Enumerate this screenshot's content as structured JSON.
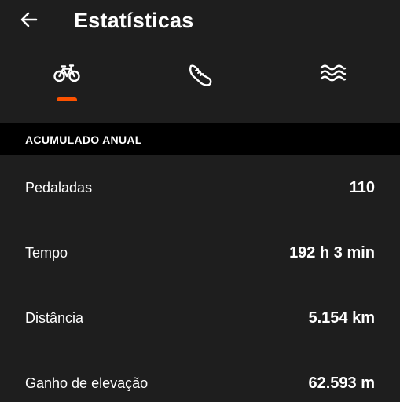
{
  "header": {
    "title": "Estatísticas",
    "back_icon": "arrow-left-icon"
  },
  "tabs": [
    {
      "name": "ride",
      "icon": "bike-icon",
      "active": true
    },
    {
      "name": "run",
      "icon": "shoe-icon",
      "active": false
    },
    {
      "name": "swim",
      "icon": "waves-icon",
      "active": false
    }
  ],
  "colors": {
    "background": "#1e1e1e",
    "section_header_bg": "#000000",
    "accent": "#fc5200",
    "text": "#ffffff"
  },
  "section": {
    "title": "ACUMULADO ANUAL"
  },
  "stats": [
    {
      "label": "Pedaladas",
      "value": "110"
    },
    {
      "label": "Tempo",
      "value": "192 h 3 min"
    },
    {
      "label": "Distância",
      "value": "5.154 km"
    },
    {
      "label": "Ganho de elevação",
      "value": "62.593 m"
    }
  ]
}
